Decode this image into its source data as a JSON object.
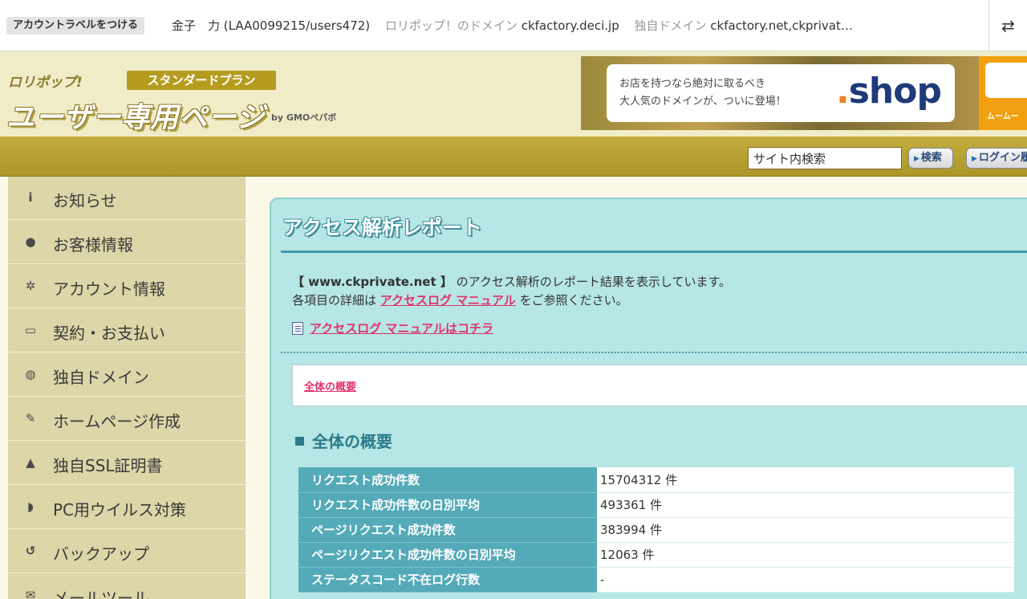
{
  "account_bar": {
    "label_button": "アカウントラベルをつける",
    "name": "金子　力 (LAA0099215/users472)",
    "lolipop_domain_label": "ロリポップ！のドメイン",
    "lolipop_domain": "ckfactory.deci.jp",
    "own_domain_label": "独自ドメイン",
    "own_domain": "ckfactory.net,ckprivat…",
    "toggle_icon": "⇄"
  },
  "banner": {
    "brand": "ロリポップ!",
    "plan": "スタンダードプラン",
    "title": "ユーザー専用ページ",
    "by": "by GMOペパボ",
    "ad_text": "お店を持つなら絶対に取るべき\n大人気のドメインが、ついに登場！",
    "ad_shop_dot": ".",
    "ad_shop": "shop",
    "ad2_text": "ムームー"
  },
  "search": {
    "placeholder": "サイト内検索",
    "search_button": "検索",
    "login_button": "ログイン履"
  },
  "sidebar": {
    "items": [
      {
        "icon": "i",
        "label": "お知らせ"
      },
      {
        "icon": "●",
        "label": "お客様情報"
      },
      {
        "icon": "✲",
        "label": "アカウント情報"
      },
      {
        "icon": "▭",
        "label": "契約・お支払い"
      },
      {
        "icon": "◍",
        "label": "独自ドメイン"
      },
      {
        "icon": "✎",
        "label": "ホームページ作成"
      },
      {
        "icon": "▲",
        "label": "独自SSL証明書"
      },
      {
        "icon": "◗",
        "label": "PC用ウイルス対策"
      },
      {
        "icon": "↺",
        "label": "バックアップ"
      },
      {
        "icon": "✉",
        "label": "メールツール"
      }
    ]
  },
  "main": {
    "title": "アクセス解析レポート",
    "intro_domain": "【 www.ckprivate.net 】",
    "intro_line1_suffix": " のアクセス解析のレポート結果を表示しています。",
    "intro_line2_prefix": "各項目の詳細は ",
    "intro_link": "アクセスログ マニュアル",
    "intro_line2_suffix": " をご参照ください。",
    "manual_link": "アクセスログ マニュアルはコチラ",
    "toc_link": "全体の概要",
    "section_title": "全体の概要",
    "stats": [
      {
        "label": "リクエスト成功件数",
        "value": "15704312 件"
      },
      {
        "label": "リクエスト成功件数の日別平均",
        "value": "493361 件"
      },
      {
        "label": "ページリクエスト成功件数",
        "value": "383994 件"
      },
      {
        "label": "ページリクエスト成功件数の日別平均",
        "value": "12063 件"
      },
      {
        "label": "ステータスコード不在ログ行数",
        "value": "-"
      }
    ]
  }
}
